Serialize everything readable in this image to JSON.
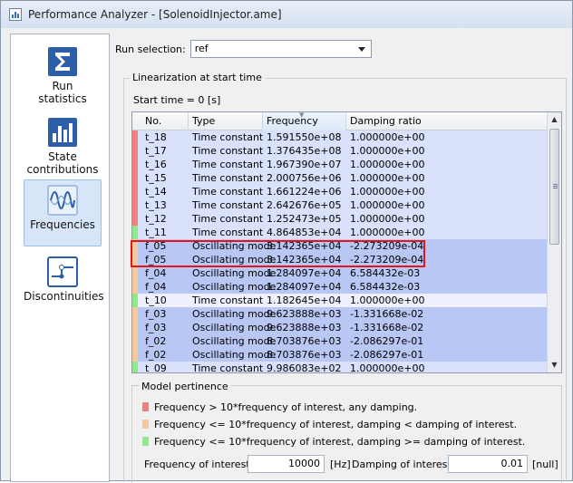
{
  "window": {
    "title": "Performance Analyzer - [SolenoidInjector.ame]"
  },
  "sidebar": {
    "items": [
      {
        "label": "Run\nstatistics",
        "icon": "sigma-icon"
      },
      {
        "label": "State\ncontributions",
        "icon": "bar-chart-icon"
      },
      {
        "label": "Frequencies",
        "icon": "wave-icon",
        "active": true
      },
      {
        "label": "Discontinuities",
        "icon": "step-icon"
      }
    ]
  },
  "run_selection": {
    "label": "Run selection:",
    "value": "ref"
  },
  "linearization": {
    "title": "Linearization at start time",
    "start_time": "Start time = 0 [s]"
  },
  "table": {
    "columns": [
      "No.",
      "Type",
      "Frequency",
      "Damping ratio"
    ],
    "rows": [
      {
        "no": "t_18",
        "type": "Time constant",
        "frequency": "1.591550e+08",
        "damping": "1.000000e+00",
        "cat": "red"
      },
      {
        "no": "t_17",
        "type": "Time constant",
        "frequency": "1.376435e+08",
        "damping": "1.000000e+00",
        "cat": "red"
      },
      {
        "no": "t_16",
        "type": "Time constant",
        "frequency": "1.967390e+07",
        "damping": "1.000000e+00",
        "cat": "red"
      },
      {
        "no": "t_15",
        "type": "Time constant",
        "frequency": "2.000756e+06",
        "damping": "1.000000e+00",
        "cat": "red"
      },
      {
        "no": "t_14",
        "type": "Time constant",
        "frequency": "1.661224e+06",
        "damping": "1.000000e+00",
        "cat": "red"
      },
      {
        "no": "t_13",
        "type": "Time constant",
        "frequency": "2.642676e+05",
        "damping": "1.000000e+00",
        "cat": "red"
      },
      {
        "no": "t_12",
        "type": "Time constant",
        "frequency": "1.252473e+05",
        "damping": "1.000000e+00",
        "cat": "red"
      },
      {
        "no": "t_11",
        "type": "Time constant",
        "frequency": "4.864853e+04",
        "damping": "1.000000e+00",
        "cat": "green"
      },
      {
        "no": "f_05",
        "type": "Oscillating mode",
        "frequency": "3.142365e+04",
        "damping": "-2.273209e-04",
        "cat": "orange"
      },
      {
        "no": "f_05",
        "type": "Oscillating mode",
        "frequency": "3.142365e+04",
        "damping": "-2.273209e-04",
        "cat": "orange"
      },
      {
        "no": "f_04",
        "type": "Oscillating mode",
        "frequency": "1.284097e+04",
        "damping": "6.584432e-03",
        "cat": "orange"
      },
      {
        "no": "f_04",
        "type": "Oscillating mode",
        "frequency": "1.284097e+04",
        "damping": "6.584432e-03",
        "cat": "orange"
      },
      {
        "no": "t_10",
        "type": "Time constant",
        "frequency": "1.182645e+04",
        "damping": "1.000000e+00",
        "cat": "green"
      },
      {
        "no": "f_03",
        "type": "Oscillating mode",
        "frequency": "9.623888e+03",
        "damping": "-1.331668e-02",
        "cat": "orange"
      },
      {
        "no": "f_03",
        "type": "Oscillating mode",
        "frequency": "9.623888e+03",
        "damping": "-1.331668e-02",
        "cat": "orange"
      },
      {
        "no": "f_02",
        "type": "Oscillating mode",
        "frequency": "8.703876e+03",
        "damping": "-2.086297e-01",
        "cat": "orange"
      },
      {
        "no": "f_02",
        "type": "Oscillating mode",
        "frequency": "8.703876e+03",
        "damping": "-2.086297e-01",
        "cat": "orange"
      },
      {
        "no": "t_09",
        "type": "Time constant",
        "frequency": "9.986083e+02",
        "damping": "1.000000e+00",
        "cat": "green"
      }
    ]
  },
  "model_pertinence": {
    "title": "Model pertinence",
    "legend": [
      {
        "color": "#f08080",
        "text": "Frequency > 10*frequency of interest, any damping."
      },
      {
        "color": "#f8c89a",
        "text": "Frequency <= 10*frequency of interest, damping < damping of interest."
      },
      {
        "color": "#8eea8a",
        "text": "Frequency <= 10*frequency of interest, damping >= damping of interest."
      }
    ],
    "frequency_of_interest": {
      "label": "Frequency of interest:",
      "value": "10000",
      "unit": "[Hz]"
    },
    "damping_of_interest": {
      "label": "Damping of interest:",
      "value": "0.01",
      "unit": "[null]"
    }
  },
  "colors": {
    "red": "#f08080",
    "orange": "#f8c89a",
    "green": "#8eea8a",
    "row_light": "#d9e1fb",
    "row_dark": "#b9c7f4",
    "row_white": "#eef1fd",
    "highlight": "#e0161c"
  }
}
